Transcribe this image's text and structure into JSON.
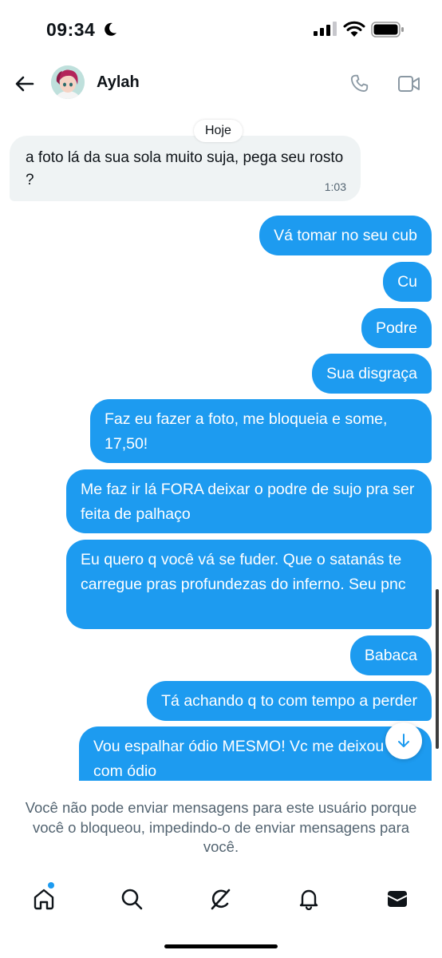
{
  "status_bar": {
    "time": "09:34"
  },
  "header": {
    "contact_name": "Aylah"
  },
  "chat": {
    "date_label": "Hoje",
    "incoming": {
      "text": "a foto lá da sua sola muito suja, pega seu rosto ?",
      "time": "1:03"
    },
    "outgoing": [
      "Vá tomar no seu cub",
      "Cu",
      "Podre",
      "Sua disgraça",
      "Faz eu fazer a foto, me bloqueia e some, 17,50!",
      "Me faz ir lá FORA deixar o podre de sujo pra ser feita de palhaço",
      "Eu quero q você vá se fuder. Que o satanás te carregue pras profundezas do inferno. Seu pnc",
      "Babaca",
      "Tá achando q to com tempo a perder",
      "Vou espalhar ódio MESMO! Vc me deixou com ódio"
    ]
  },
  "blocked_notice": "Você não pode enviar mensagens para este usuário porque você o bloqueou, impedindo-o de enviar mensagens para você.",
  "colors": {
    "accent": "#1d9bf0",
    "incoming_bubble": "#eff3f4",
    "muted_text": "#536471"
  },
  "tabbar": {
    "items": [
      "home-icon",
      "search-icon",
      "grok-icon",
      "notifications-icon",
      "messages-icon"
    ],
    "home_has_badge": true
  }
}
